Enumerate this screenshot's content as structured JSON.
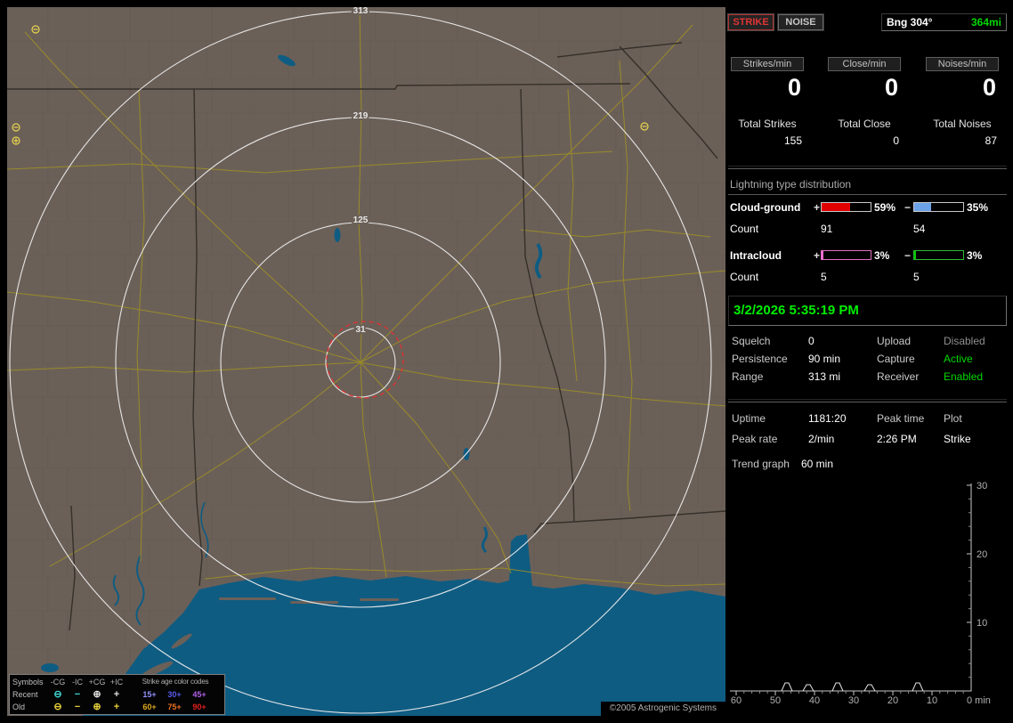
{
  "colors": {
    "accent_red": "#e03434",
    "accent_green": "#00e000",
    "bar_red": "#e00000",
    "bar_blue": "#6ca2e8",
    "bar_pink": "#ff6ad5",
    "bar_green": "#00c800",
    "map_land": "#6b6058",
    "map_water": "#0f5c82",
    "road_yellow": "#9d8f25",
    "ring_white": "#ececec",
    "noise_yellow": "#e8d44d",
    "alarm_ring_red": "#e23030"
  },
  "map": {
    "ring_labels": [
      "313",
      "219",
      "125",
      "31"
    ],
    "legend": {
      "symbols_header": "Symbols",
      "columns": [
        "-CG",
        "-IC",
        "+CG",
        "+IC"
      ],
      "symbols": [
        "⊖",
        "−",
        "⊕",
        "+"
      ],
      "age_header": "Strike age color codes",
      "recent_label": "Recent",
      "recent_ages": [
        "15+",
        "30+",
        "45+"
      ],
      "old_label": "Old",
      "old_ages": [
        "60+",
        "75+",
        "90+"
      ]
    },
    "copyright": "©2005 Astrogenic Systems"
  },
  "panel": {
    "strike_button": "STRIKE",
    "noise_button": "NOISE",
    "bearing": {
      "label": "Bng 304°",
      "range": "364mi"
    },
    "rates": [
      {
        "header": "Strikes/min",
        "value": "0",
        "total_label": "Total Strikes",
        "total_value": "155"
      },
      {
        "header": "Close/min",
        "value": "0",
        "total_label": "Total Close",
        "total_value": "0"
      },
      {
        "header": "Noises/min",
        "value": "0",
        "total_label": "Total Noises",
        "total_value": "87"
      }
    ],
    "distribution": {
      "title": "Lightning type distribution",
      "plus": "+",
      "minus": "−",
      "count_label": "Count",
      "cloud_ground": {
        "label": "Cloud-ground",
        "plus_pct": 59,
        "plus_pct_text": "59%",
        "plus_count": "91",
        "minus_pct": 35,
        "minus_pct_text": "35%",
        "minus_count": "54"
      },
      "intracloud": {
        "label": "Intracloud",
        "plus_pct": 3,
        "plus_pct_text": "3%",
        "plus_count": "5",
        "minus_pct": 3,
        "minus_pct_text": "3%",
        "minus_count": "5"
      }
    },
    "datetime": "3/2/2026 5:35:19 PM",
    "settings": {
      "squelch_label": "Squelch",
      "squelch_value": "0",
      "persistence_label": "Persistence",
      "persistence_value": "90 min",
      "range_label": "Range",
      "range_value": "313 mi",
      "upload_label": "Upload",
      "upload_value": "Disabled",
      "capture_label": "Capture",
      "capture_value": "Active",
      "receiver_label": "Receiver",
      "receiver_value": "Enabled"
    },
    "stats": {
      "uptime_label": "Uptime",
      "uptime_value": "1181:20",
      "peak_time_label": "Peak time",
      "peak_time_value": "2:26 PM",
      "plot_label": "Plot",
      "plot_value": "Strike",
      "peak_rate_label": "Peak rate",
      "peak_rate_value": "2/min",
      "trend_label": "Trend graph",
      "trend_value": "60 min"
    },
    "graph": {
      "y_ticks": [
        "30",
        "20",
        "10"
      ],
      "x_ticks": [
        "60",
        "50",
        "40",
        "30",
        "20",
        "10"
      ],
      "x_end_label": "0 min",
      "approx_spike_times_min": [
        48,
        43,
        35,
        27,
        15
      ]
    }
  }
}
